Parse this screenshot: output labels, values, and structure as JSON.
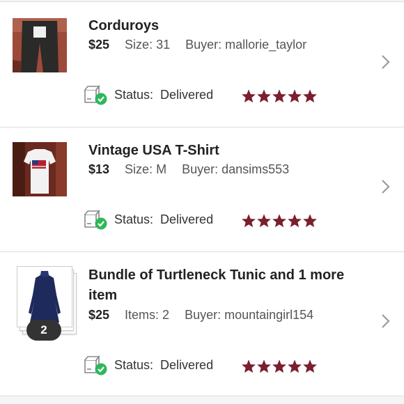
{
  "orders": [
    {
      "title": "Corduroys",
      "price": "$25",
      "detail": "Size: 31",
      "buyer": "Buyer: mallorie_taylor",
      "status_label": "Status:",
      "status_value": "Delivered",
      "rating": 5
    },
    {
      "title": "Vintage USA T-Shirt",
      "price": "$13",
      "detail": "Size: M",
      "buyer": "Buyer: dansims553",
      "status_label": "Status:",
      "status_value": "Delivered",
      "rating": 5
    },
    {
      "title_line1": "Bundle of Turtleneck Tunic and 1 more",
      "title_line2": "item",
      "price": "$25",
      "detail": "Items: 2",
      "buyer": "Buyer: mountaingirl154",
      "status_label": "Status:",
      "status_value": "Delivered",
      "rating": 5,
      "bundle_count": "2"
    }
  ],
  "colors": {
    "star": "#7a1f2e",
    "check": "#2eb85c",
    "chevron": "#9a9a9a"
  },
  "icons": [
    "delivered-box-icon",
    "star-icon",
    "chevron-right-icon"
  ]
}
